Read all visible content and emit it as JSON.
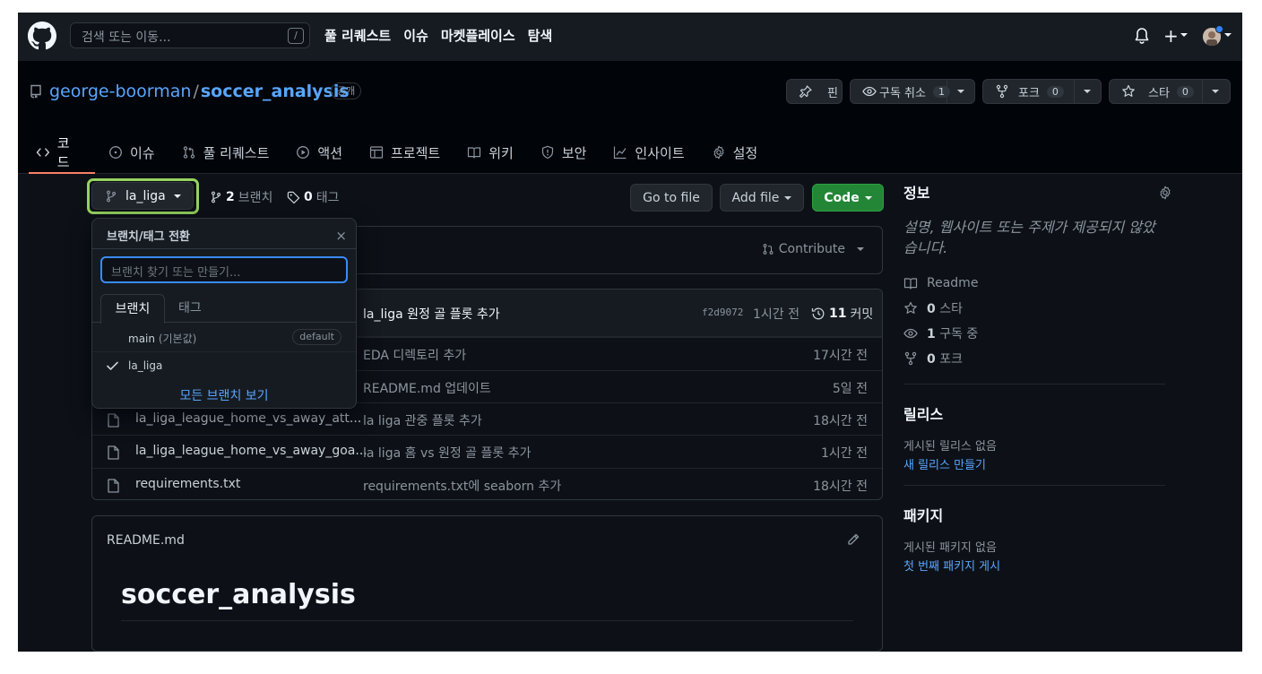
{
  "header": {
    "search_placeholder": "검색 또는 이동...",
    "search_shortcut": "/",
    "nav": [
      "풀 리퀘스트",
      "이슈",
      "마켓플레이스",
      "탐색"
    ],
    "new_label": "+"
  },
  "repo": {
    "owner": "george-boorman",
    "separator": "/",
    "name": "soccer_analysis",
    "visibility": "공개",
    "pin_label": "핀",
    "watch_label": "구독 취소",
    "watch_count": "1",
    "fork_label": "포크",
    "fork_count": "0",
    "star_label": "스타",
    "star_count": "0"
  },
  "tabs": [
    {
      "label": "코드",
      "icon": "code-icon",
      "active": true
    },
    {
      "label": "이슈",
      "icon": "issue-icon"
    },
    {
      "label": "풀 리퀘스트",
      "icon": "pull-request-icon"
    },
    {
      "label": "액션",
      "icon": "play-icon"
    },
    {
      "label": "프로젝트",
      "icon": "table-icon"
    },
    {
      "label": "위키",
      "icon": "book-icon"
    },
    {
      "label": "보안",
      "icon": "shield-icon"
    },
    {
      "label": "인사이트",
      "icon": "graph-icon"
    },
    {
      "label": "설정",
      "icon": "gear-icon"
    }
  ],
  "toolbar": {
    "branch": "la_liga",
    "branch_count": "2",
    "branch_label": "브랜치",
    "tag_count": "0",
    "tag_label": "태그",
    "go_to_file": "Go to file",
    "add_file": "Add file",
    "code": "Code",
    "contribute": "Contribute"
  },
  "commit": {
    "message": "la_liga 원정 골 플롯 추가",
    "sha": "f2d9072",
    "time": "1시간 전",
    "count": "11",
    "count_label": "커밋"
  },
  "files": [
    {
      "name": "",
      "message": "EDA 디렉토리 추가",
      "time": "17시간 전"
    },
    {
      "name": "",
      "message": "README.md 업데이트",
      "time": "5일 전"
    },
    {
      "name": "la_liga_league_home_vs_away_att...",
      "message": "la liga 관중 플롯 추가",
      "time": "18시간 전"
    },
    {
      "name": "la_liga_league_home_vs_away_goa...",
      "message": "la liga 홈 vs 원정 골 플롯 추가",
      "time": "1시간 전"
    },
    {
      "name": "requirements.txt",
      "message": "requirements.txt에 seaborn 추가",
      "time": "18시간 전"
    }
  ],
  "readme": {
    "filename": "README.md",
    "heading": "soccer_analysis"
  },
  "dropdown": {
    "title": "브랜치/태그 전환",
    "close": "×",
    "input_placeholder": "브랜치 찾기 또는 만들기...",
    "tab_branches": "브랜치",
    "tab_tags": "태그",
    "items": [
      {
        "name": "main",
        "suffix": "(기본값)",
        "badge": "default"
      },
      {
        "name": "la_liga",
        "checked": true
      }
    ],
    "view_all": "모든 브랜치 보기"
  },
  "sidebar": {
    "about_title": "정보",
    "about_desc": "설명, 웹사이트 또는 주제가 제공되지 않았습니다.",
    "readme": "Readme",
    "stars_count": "0",
    "stars_label": "스타",
    "watching_count": "1",
    "watching_label": "구독 중",
    "forks_count": "0",
    "forks_label": "포크",
    "releases_title": "릴리스",
    "releases_none": "게시된 릴리스 없음",
    "releases_link": "새 릴리스 만들기",
    "packages_title": "패키지",
    "packages_none": "게시된 패키지 없음",
    "packages_link": "첫 번째 패키지 게시"
  },
  "colors": {
    "background": "#0d1117",
    "header": "#161b22",
    "accent_link": "#58a6ff",
    "green_button": "#238636",
    "tab_underline": "#f78166",
    "highlight_ring": "#96d35f"
  }
}
